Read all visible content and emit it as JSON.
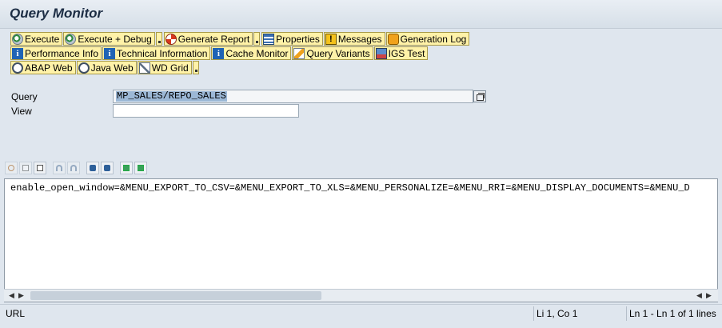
{
  "window": {
    "title": "Query Monitor"
  },
  "toolbar": {
    "row1": [
      {
        "label": "Execute",
        "icon": "execute-icon"
      },
      {
        "label": "Execute + Debug",
        "icon": "execute-debug-icon"
      },
      {
        "label": "Generate Report",
        "icon": "generate-report-icon"
      },
      {
        "label": "Properties",
        "icon": "properties-icon"
      },
      {
        "label": "Messages",
        "icon": "messages-icon"
      },
      {
        "label": "Generation Log",
        "icon": "generation-log-icon"
      }
    ],
    "row2": [
      {
        "label": "Performance Info",
        "icon": "info-icon"
      },
      {
        "label": "Technical Information",
        "icon": "info-icon"
      },
      {
        "label": "Cache Monitor",
        "icon": "info-icon"
      },
      {
        "label": "Query Variants",
        "icon": "query-variants-icon"
      },
      {
        "label": "IGS Test",
        "icon": "igs-icon"
      }
    ],
    "row3": [
      {
        "label": "ABAP Web",
        "icon": "web-icon"
      },
      {
        "label": "Java Web",
        "icon": "web-icon"
      },
      {
        "label": "WD Grid",
        "icon": "grid-icon"
      }
    ]
  },
  "form": {
    "query_label": "Query",
    "query_value": "MP_SALES/REPO_SALES",
    "view_label": "View",
    "view_value": ""
  },
  "editor": {
    "text": "enable_open_window=&MENU_EXPORT_TO_CSV=&MENU_EXPORT_TO_XLS=&MENU_PERSONALIZE=&MENU_RRI=&MENU_DISPLAY_DOCUMENTS=&MENU_D"
  },
  "status": {
    "left": "URL",
    "position": "Li 1, Co 1",
    "lines": "Ln 1 - Ln 1 of 1 lines"
  }
}
